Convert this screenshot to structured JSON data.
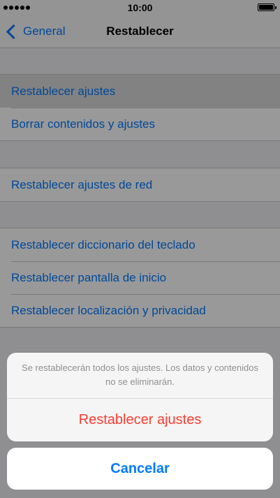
{
  "status_bar": {
    "time": "10:00"
  },
  "nav": {
    "back_label": "General",
    "title": "Restablecer"
  },
  "groups": [
    {
      "items": [
        "Restablecer ajustes",
        "Borrar contenidos y ajustes"
      ]
    },
    {
      "items": [
        "Restablecer ajustes de red"
      ]
    },
    {
      "items": [
        "Restablecer diccionario del teclado",
        "Restablecer pantalla de inicio",
        "Restablecer localización y privacidad"
      ]
    }
  ],
  "action_sheet": {
    "message": "Se restablecerán todos los ajustes. Los datos y contenidos no se eliminarán.",
    "destructive_label": "Restablecer ajustes",
    "cancel_label": "Cancelar"
  },
  "colors": {
    "accent": "#007aff",
    "destructive": "#ff3b30",
    "background": "#efeff4"
  }
}
